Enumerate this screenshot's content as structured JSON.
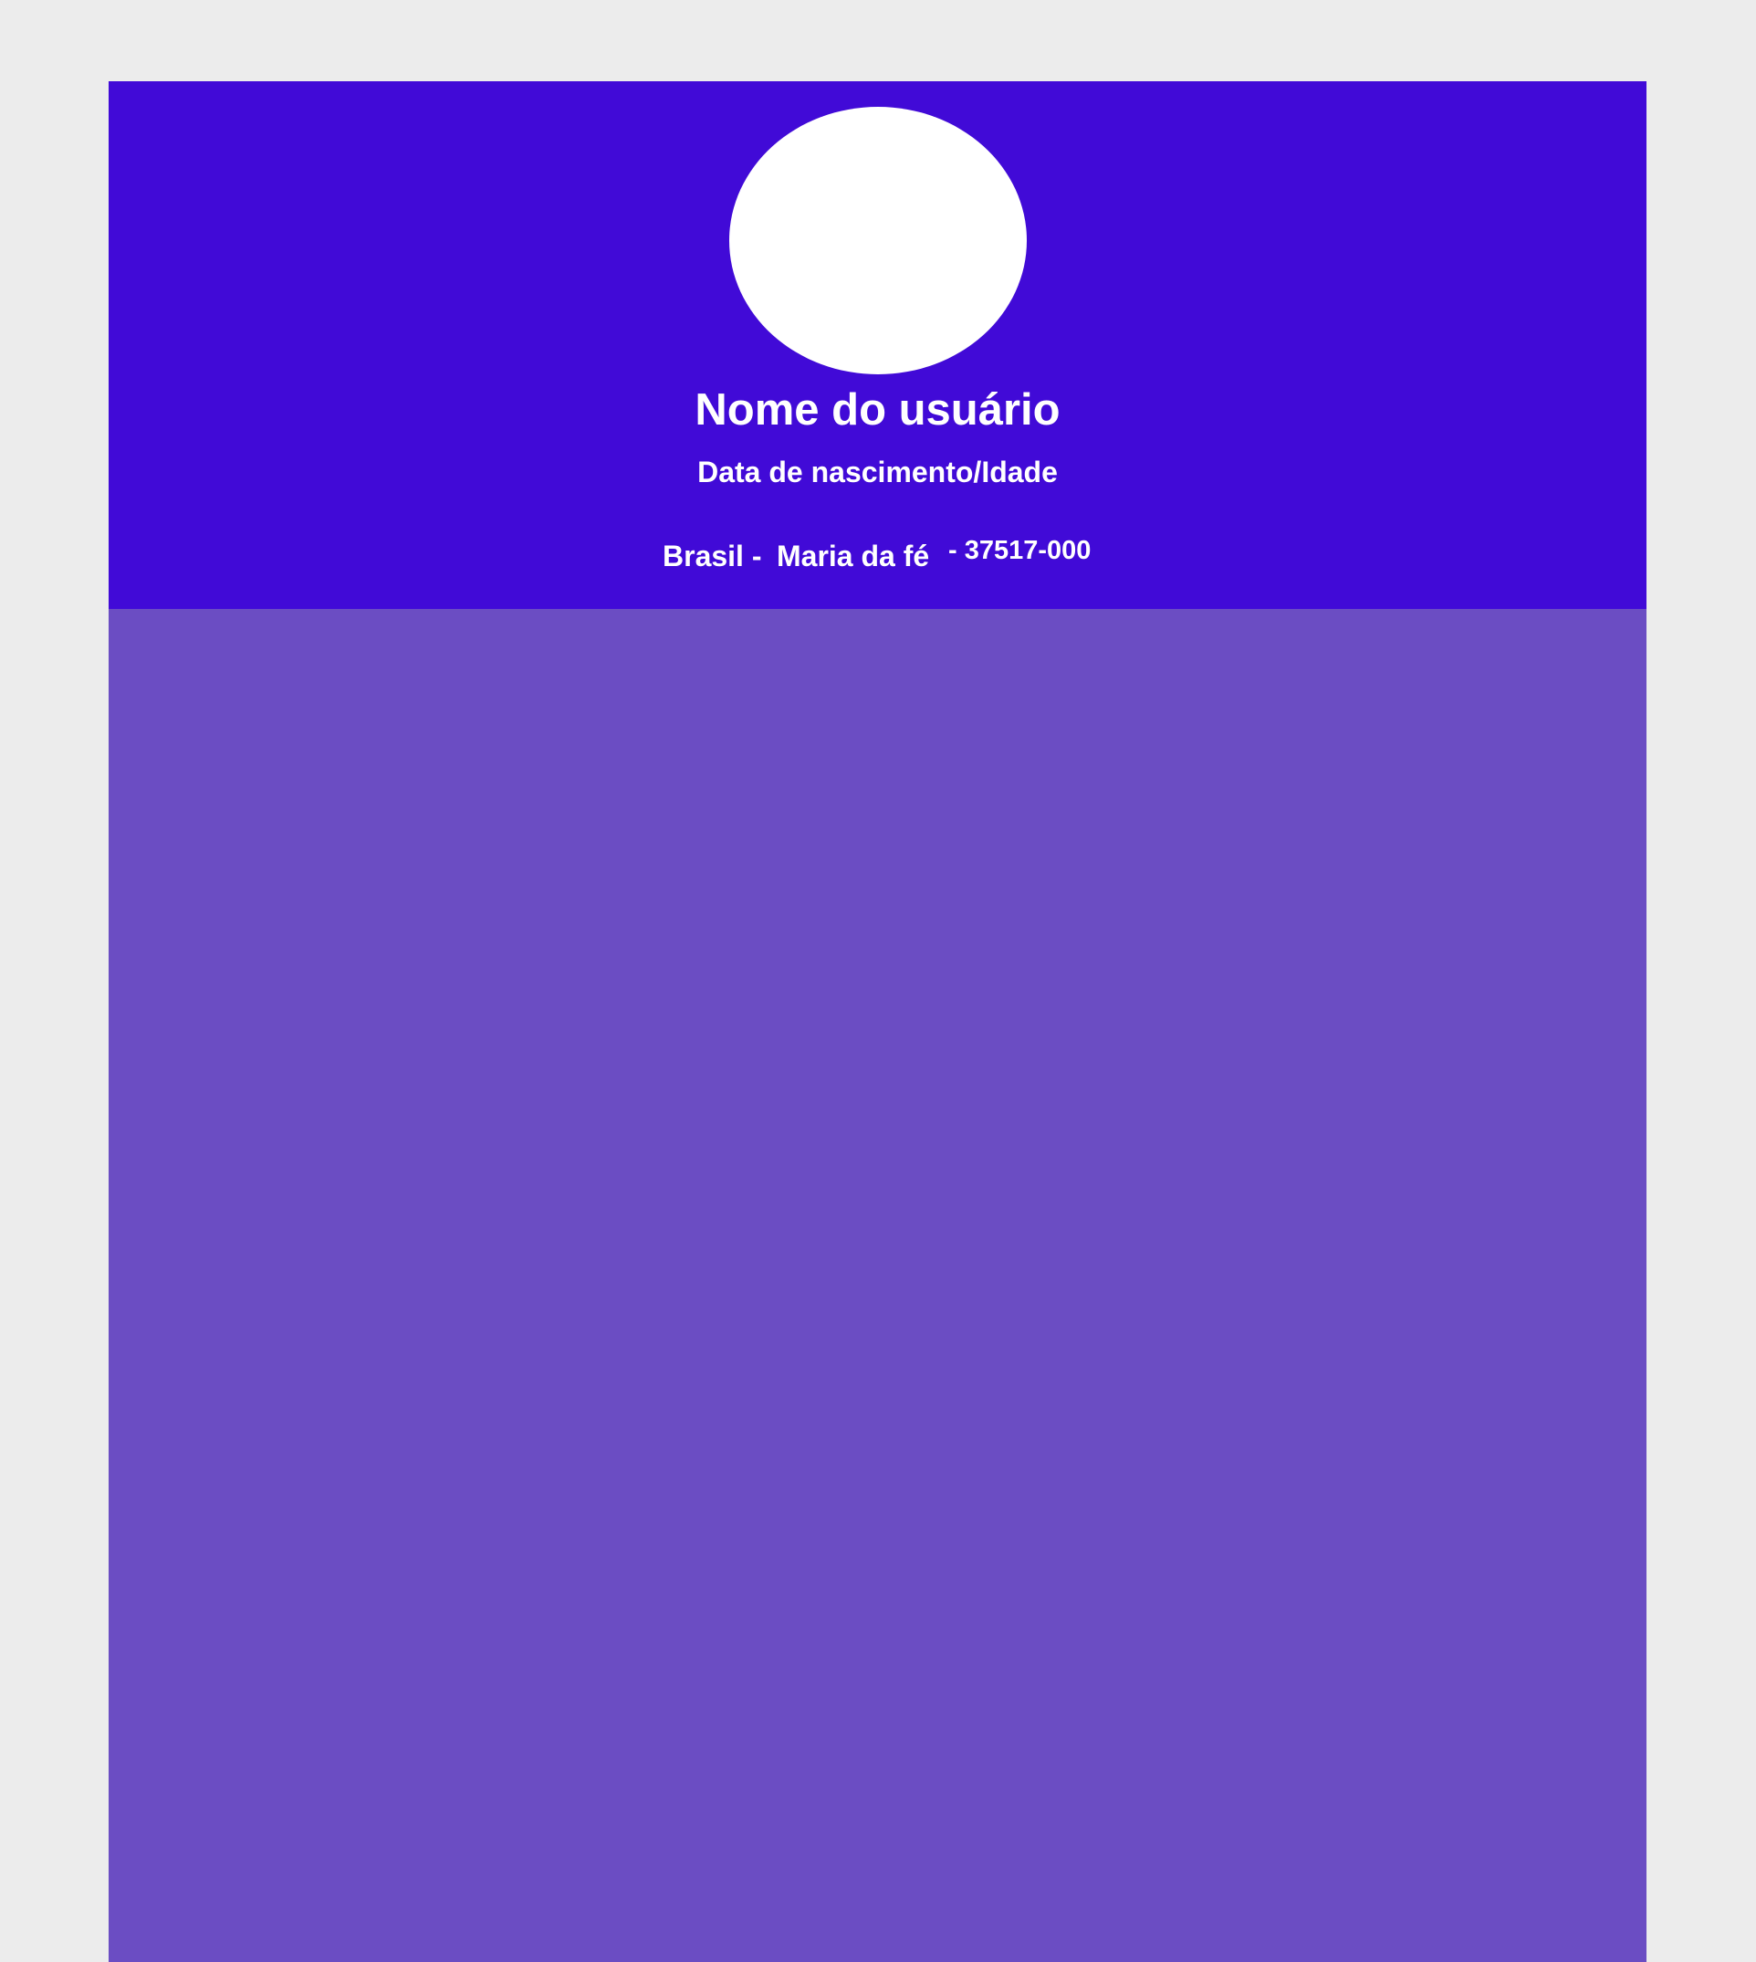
{
  "profile": {
    "user_name": "Nome do usuário",
    "birth_info": "Data de nascimento/Idade",
    "location": {
      "country": "Brasil -",
      "city": "Maria da fé",
      "zip": "- 37517-000"
    }
  },
  "colors": {
    "page_background": "#ececec",
    "header_background": "#410ad7",
    "content_background": "#6b4dc3",
    "avatar": "#ffffff",
    "text": "#ffffff"
  }
}
